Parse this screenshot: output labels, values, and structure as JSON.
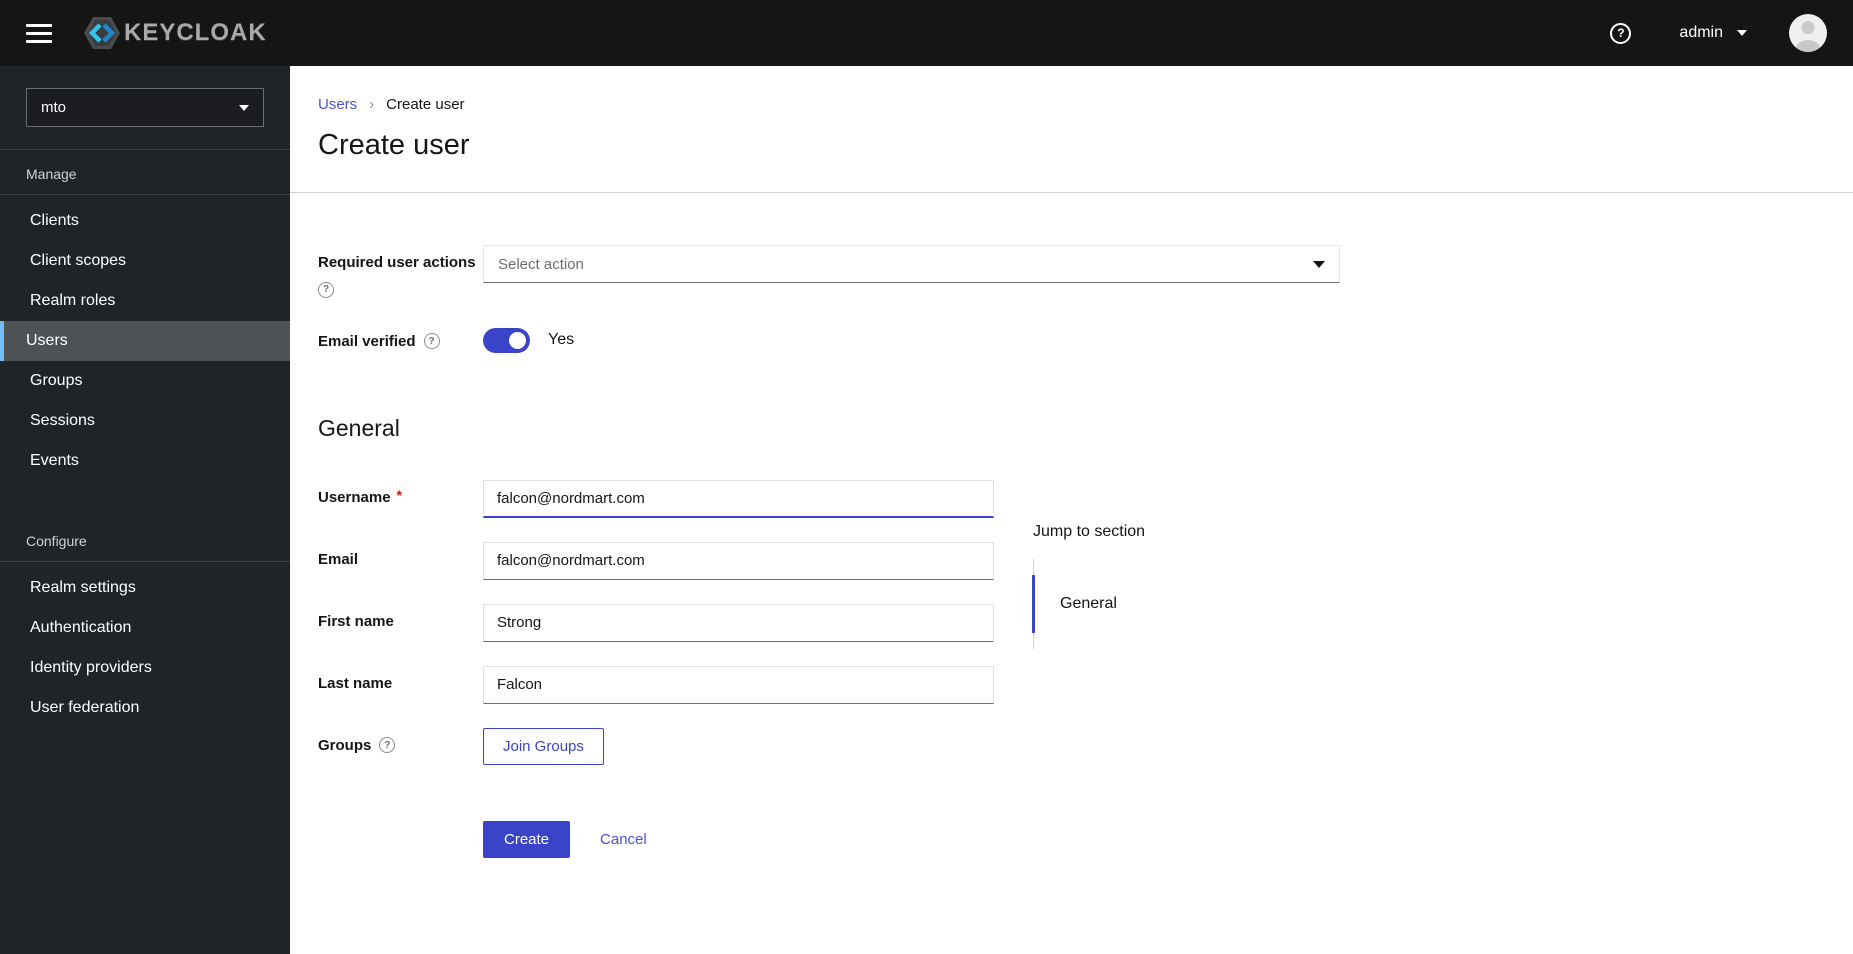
{
  "colors": {
    "accent": "#3b44c8",
    "link": "#4d53d1",
    "header_bg": "#151515",
    "sidebar_bg": "#212427",
    "sidebar_active_bg": "#4f5255",
    "sidebar_active_border": "#73bcf7",
    "required_red": "#c9190b"
  },
  "icons": {
    "help_glyph": "?"
  },
  "header": {
    "brand": "KEYCLOAK",
    "username": "admin"
  },
  "sidebar": {
    "realm": "mto",
    "sections": [
      {
        "label": "Manage",
        "items": [
          {
            "label": "Clients",
            "active": false
          },
          {
            "label": "Client scopes",
            "active": false
          },
          {
            "label": "Realm roles",
            "active": false
          },
          {
            "label": "Users",
            "active": true
          },
          {
            "label": "Groups",
            "active": false
          },
          {
            "label": "Sessions",
            "active": false
          },
          {
            "label": "Events",
            "active": false
          }
        ]
      },
      {
        "label": "Configure",
        "items": [
          {
            "label": "Realm settings",
            "active": false
          },
          {
            "label": "Authentication",
            "active": false
          },
          {
            "label": "Identity providers",
            "active": false
          },
          {
            "label": "User federation",
            "active": false
          }
        ]
      }
    ]
  },
  "breadcrumb": {
    "link": "Users",
    "separator": "›",
    "current": "Create user"
  },
  "page": {
    "title": "Create user"
  },
  "form": {
    "required_marker": "*",
    "required_user_actions": {
      "label": "Required user actions",
      "placeholder": "Select action"
    },
    "email_verified": {
      "label": "Email verified",
      "state_label": "Yes",
      "on": true
    },
    "general_heading": "General",
    "fields": [
      {
        "label": "Username",
        "required": true,
        "value": "falcon@nordmart.com",
        "focused": true
      },
      {
        "label": "Email",
        "required": false,
        "value": "falcon@nordmart.com",
        "focused": false
      },
      {
        "label": "First name",
        "required": false,
        "value": "Strong",
        "focused": false
      },
      {
        "label": "Last name",
        "required": false,
        "value": "Falcon",
        "focused": false
      }
    ],
    "groups": {
      "label": "Groups",
      "button_label": "Join Groups"
    },
    "actions": {
      "create_label": "Create",
      "cancel_label": "Cancel"
    }
  },
  "jump_to_section": {
    "title": "Jump to section",
    "items": [
      {
        "label": "General",
        "active": true
      }
    ]
  }
}
